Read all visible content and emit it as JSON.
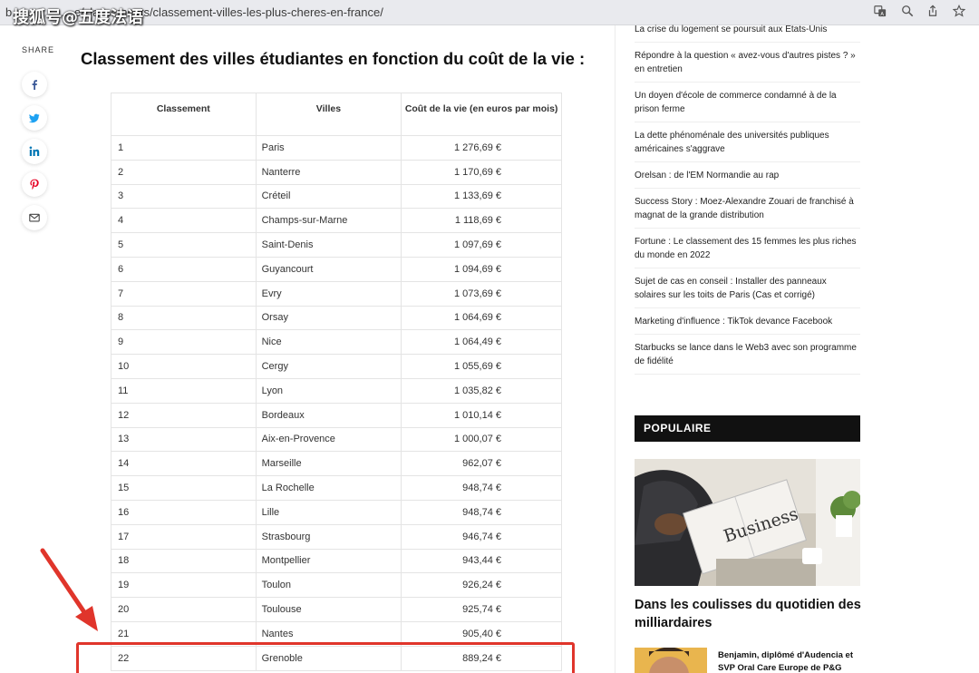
{
  "browser": {
    "url": "b...................e/classements/classement-villes-les-plus-cheres-en-france/",
    "watermark": "搜狐号@五度法语"
  },
  "share": {
    "label": "SHARE",
    "icons": [
      "facebook-icon",
      "twitter-icon",
      "linkedin-icon",
      "pinterest-icon",
      "email-icon"
    ]
  },
  "article": {
    "title": "Classement des villes étudiantes en fonction du coût de la vie :",
    "table": {
      "headers": [
        "Classement",
        "Villes",
        "Coût de la vie (en euros par mois)"
      ],
      "rows": [
        [
          "1",
          "Paris",
          "1 276,69 €"
        ],
        [
          "2",
          "Nanterre",
          "1 170,69 €"
        ],
        [
          "3",
          "Créteil",
          "1 133,69 €"
        ],
        [
          "4",
          "Champs-sur-Marne",
          "1 118,69 €"
        ],
        [
          "5",
          "Saint-Denis",
          "1 097,69 €"
        ],
        [
          "6",
          "Guyancourt",
          "1 094,69 €"
        ],
        [
          "7",
          "Evry",
          "1 073,69 €"
        ],
        [
          "8",
          "Orsay",
          "1 064,69 €"
        ],
        [
          "9",
          "Nice",
          "1 064,49 €"
        ],
        [
          "10",
          "Cergy",
          "1 055,69 €"
        ],
        [
          "11",
          "Lyon",
          "1 035,82 €"
        ],
        [
          "12",
          "Bordeaux",
          "1 010,14 €"
        ],
        [
          "13",
          "Aix-en-Provence",
          "1 000,07 €"
        ],
        [
          "14",
          "Marseille",
          "962,07 €"
        ],
        [
          "15",
          "La Rochelle",
          "948,74 €"
        ],
        [
          "16",
          "Lille",
          "948,74 €"
        ],
        [
          "17",
          "Strasbourg",
          "946,74 €"
        ],
        [
          "18",
          "Montpellier",
          "943,44 €"
        ],
        [
          "19",
          "Toulon",
          "926,24 €"
        ],
        [
          "20",
          "Toulouse",
          "925,74 €"
        ],
        [
          "21",
          "Nantes",
          "905,40 €"
        ],
        [
          "22",
          "Grenoble",
          "889,24 €"
        ]
      ],
      "highlighted_row": 22
    }
  },
  "sidebar": {
    "recent": [
      "La crise du logement se poursuit aux Etats-Unis",
      "Répondre à la question « avez-vous d'autres pistes ? » en entretien",
      "Un doyen d'école de commerce condamné à de la prison ferme",
      "La dette phénoménale des universités publiques américaines s'aggrave",
      "Orelsan : de l'EM Normandie au rap",
      "Success Story : Moez-Alexandre Zouari de franchisé à magnat de la grande distribution",
      "Fortune : Le classement des 15 femmes les plus riches du monde en 2022",
      "Sujet de cas en conseil : Installer des panneaux solaires sur les toits de Paris (Cas et corrigé)",
      "Marketing d'influence : TikTok devance Facebook",
      "Starbucks se lance dans le Web3 avec son programme de fidélité"
    ],
    "popular": {
      "header": "POPULAIRE",
      "image_text": "Business",
      "main_title": "Dans les coulisses du quotidien des milliardaires",
      "next_title": "Benjamin, diplômé d'Audencia et SVP Oral Care Europe de P&G"
    }
  },
  "colors": {
    "highlight": "#e0352b",
    "popular_header_bg": "#111111"
  }
}
